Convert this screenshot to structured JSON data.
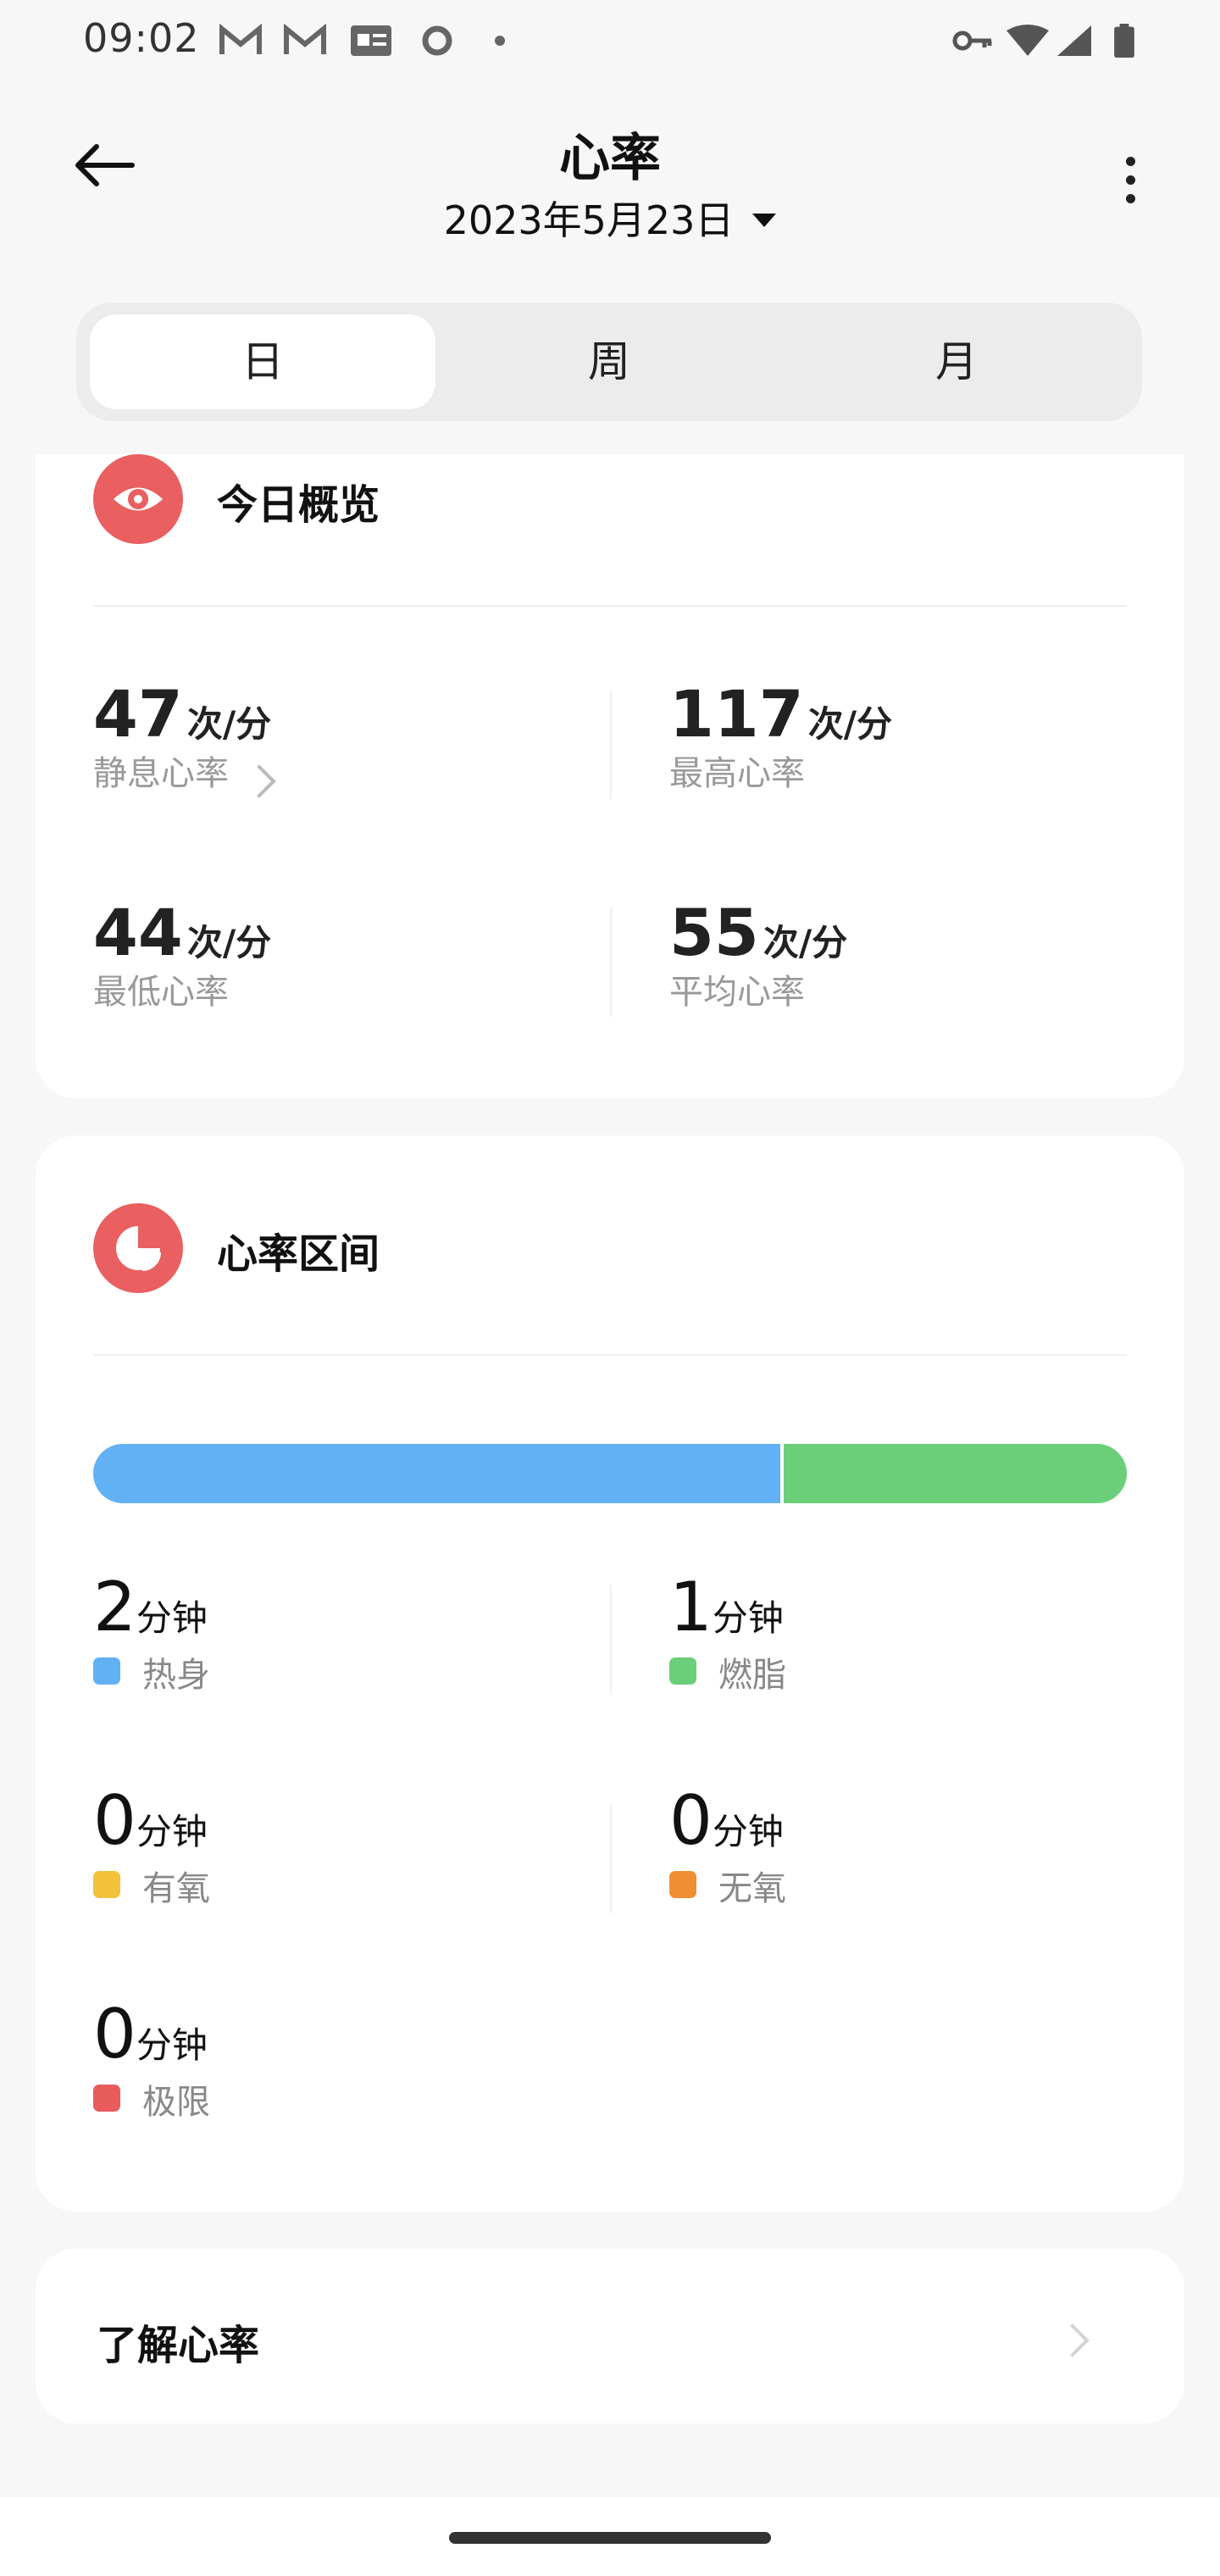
{
  "status": {
    "time": "09:02"
  },
  "header": {
    "title": "心率",
    "date": "2023年5月23日"
  },
  "tabs": [
    {
      "label": "日",
      "active": true
    },
    {
      "label": "周",
      "active": false
    },
    {
      "label": "月",
      "active": false
    }
  ],
  "overview": {
    "title": "今日概览",
    "resting": {
      "value": "47",
      "unit": "次/分",
      "label": "静息心率"
    },
    "max": {
      "value": "117",
      "unit": "次/分",
      "label": "最高心率"
    },
    "min": {
      "value": "44",
      "unit": "次/分",
      "label": "最低心率"
    },
    "avg": {
      "value": "55",
      "unit": "次/分",
      "label": "平均心率"
    }
  },
  "zones": {
    "title": "心率区间",
    "bar": [
      {
        "name": "热身",
        "fraction": 0.667,
        "color": "#62b1f5"
      },
      {
        "name": "燃脂",
        "fraction": 0.333,
        "color": "#6bcf7a"
      }
    ],
    "items": [
      {
        "value": "2",
        "unit": "分钟",
        "label": "热身",
        "color": "#62b1f5"
      },
      {
        "value": "1",
        "unit": "分钟",
        "label": "燃脂",
        "color": "#6bcf7a"
      },
      {
        "value": "0",
        "unit": "分钟",
        "label": "有氧",
        "color": "#f2c23a"
      },
      {
        "value": "0",
        "unit": "分钟",
        "label": "无氧",
        "color": "#ef8e33"
      },
      {
        "value": "0",
        "unit": "分钟",
        "label": "极限",
        "color": "#e95c5c"
      }
    ]
  },
  "learn": {
    "label": "了解心率"
  },
  "icons": [
    "back-arrow-icon",
    "more-vert-icon",
    "eye-icon",
    "pie-icon",
    "chevron-right-icon",
    "gmail-icon",
    "wifi-icon",
    "signal-icon",
    "battery-icon",
    "key-icon"
  ]
}
